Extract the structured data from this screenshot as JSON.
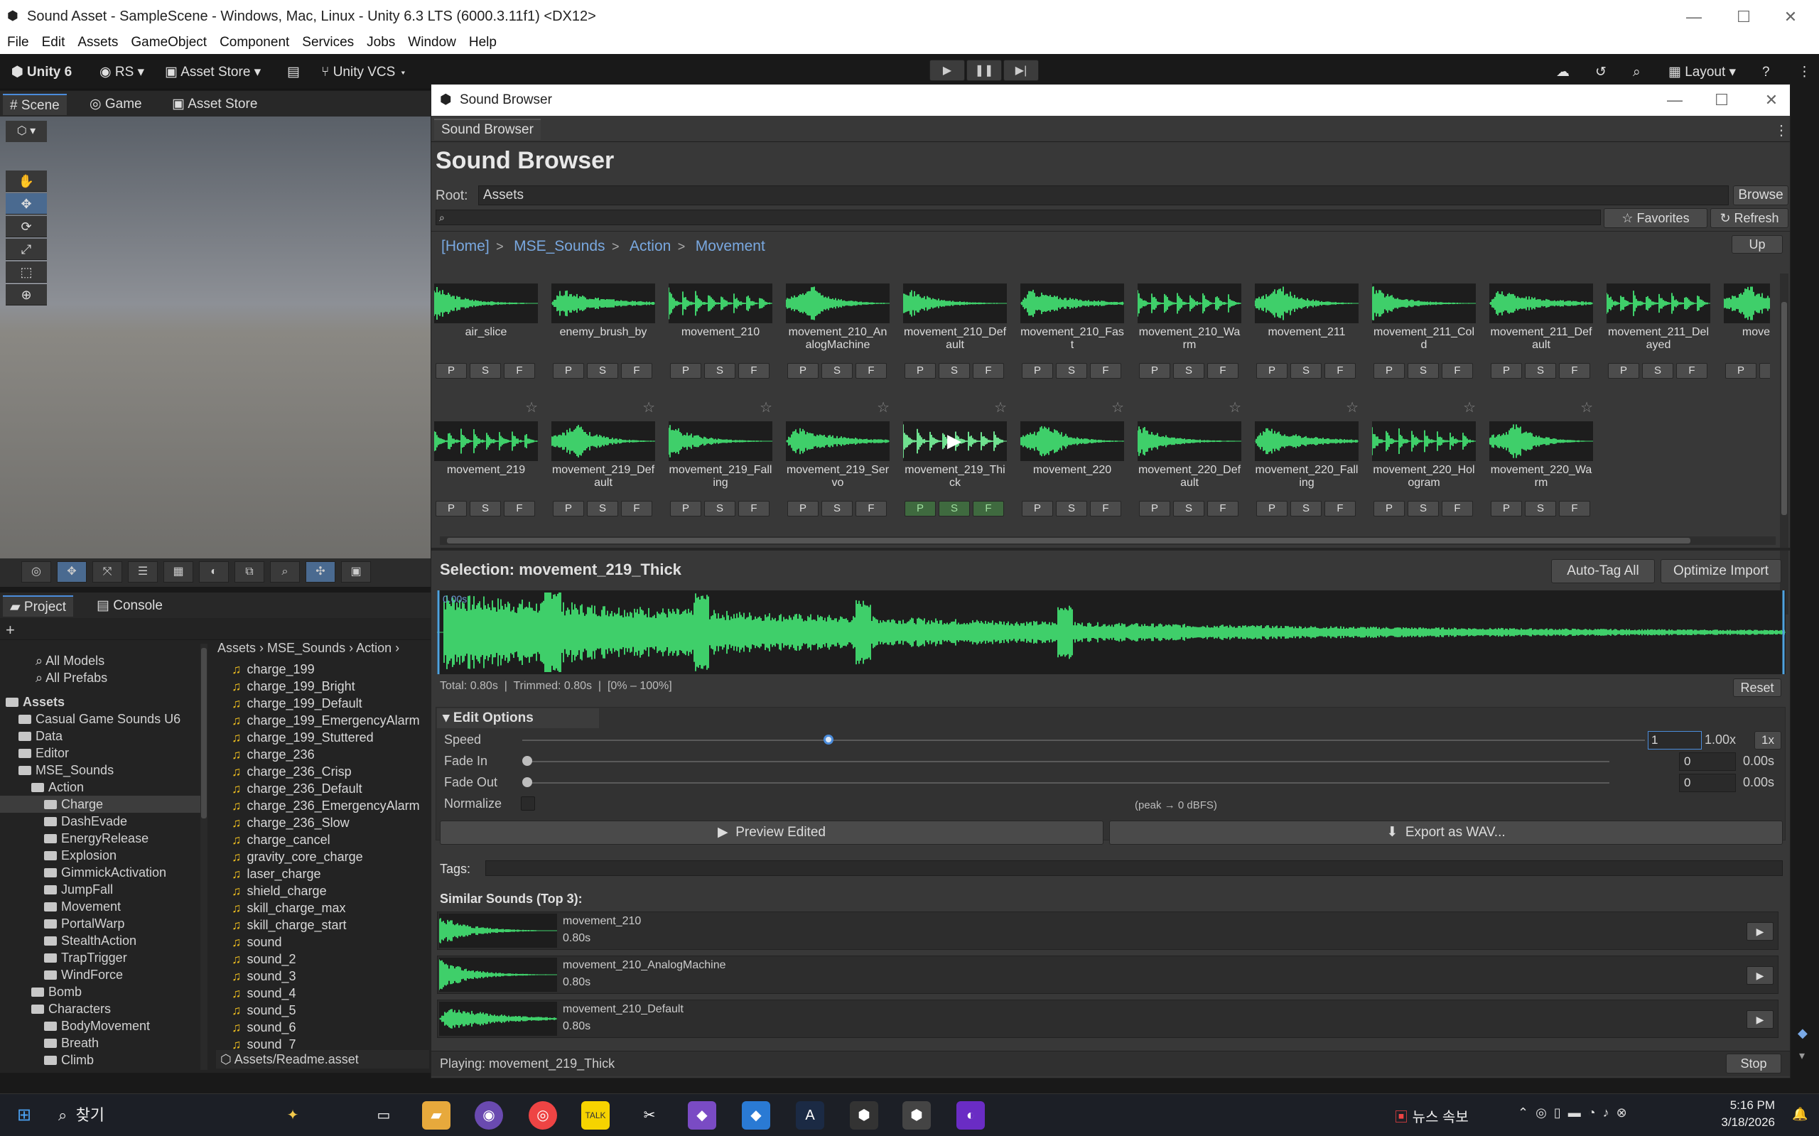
{
  "window": {
    "title": "Sound Asset - SampleScene - Windows, Mac, Linux - Unity 6.3 LTS (6000.3.11f1) <DX12>"
  },
  "menu": [
    "File",
    "Edit",
    "Assets",
    "GameObject",
    "Component",
    "Services",
    "Jobs",
    "Window",
    "Help"
  ],
  "toolbar": {
    "unity": "Unity 6",
    "account": "RS",
    "asset_store": "Asset Store",
    "vcs": "Unity VCS",
    "layout": "Layout"
  },
  "scene_tabs": [
    "Scene",
    "Game",
    "Asset Store"
  ],
  "project_tabs": [
    "Project",
    "Console"
  ],
  "project": {
    "search_items": [
      "All Models",
      "All Prefabs"
    ],
    "tree": [
      {
        "label": "Assets",
        "indent": 0,
        "bold": true
      },
      {
        "label": "Casual Game Sounds U6",
        "indent": 1
      },
      {
        "label": "Data",
        "indent": 1
      },
      {
        "label": "Editor",
        "indent": 1
      },
      {
        "label": "MSE_Sounds",
        "indent": 1
      },
      {
        "label": "Action",
        "indent": 2
      },
      {
        "label": "Charge",
        "indent": 3,
        "selected": true
      },
      {
        "label": "DashEvade",
        "indent": 3
      },
      {
        "label": "EnergyRelease",
        "indent": 3
      },
      {
        "label": "Explosion",
        "indent": 3
      },
      {
        "label": "GimmickActivation",
        "indent": 3
      },
      {
        "label": "JumpFall",
        "indent": 3
      },
      {
        "label": "Movement",
        "indent": 3
      },
      {
        "label": "PortalWarp",
        "indent": 3
      },
      {
        "label": "StealthAction",
        "indent": 3
      },
      {
        "label": "TrapTrigger",
        "indent": 3
      },
      {
        "label": "WindForce",
        "indent": 3
      },
      {
        "label": "Bomb",
        "indent": 2
      },
      {
        "label": "Characters",
        "indent": 2
      },
      {
        "label": "BodyMovement",
        "indent": 3
      },
      {
        "label": "Breath",
        "indent": 3
      },
      {
        "label": "Climb",
        "indent": 3
      }
    ],
    "breadcrumb": [
      "Assets",
      "MSE_Sounds",
      "Action"
    ],
    "files": [
      "charge_199",
      "charge_199_Bright",
      "charge_199_Default",
      "charge_199_EmergencyAlarm",
      "charge_199_Stuttered",
      "charge_236",
      "charge_236_Crisp",
      "charge_236_Default",
      "charge_236_EmergencyAlarm",
      "charge_236_Slow",
      "charge_cancel",
      "gravity_core_charge",
      "laser_charge",
      "shield_charge",
      "skill_charge_max",
      "skill_charge_start",
      "sound",
      "sound_2",
      "sound_3",
      "sound_4",
      "sound_5",
      "sound_6",
      "sound_7"
    ],
    "status_path": "Assets/Readme.asset"
  },
  "sb": {
    "window_title": "Sound Browser",
    "tab": "Sound Browser",
    "heading": "Sound Browser",
    "root_label": "Root:",
    "root_value": "Assets",
    "browse": "Browse",
    "favorites": "☆ Favorites",
    "refresh": "↻ Refresh",
    "crumbs": [
      "[Home]",
      "MSE_Sounds",
      "Action",
      "Movement"
    ],
    "up": "Up",
    "row1": [
      "air_slice",
      "enemy_brush_by",
      "movement_210",
      "movement_210_AnalogMachine",
      "movement_210_Default",
      "movement_210_Fast",
      "movement_210_Warm",
      "movement_211",
      "movement_211_Cold",
      "movement_211_Default",
      "movement_211_Delayed",
      "movement_P"
    ],
    "row2": [
      "movement_219",
      "movement_219_Default",
      "movement_219_Falling",
      "movement_219_Servo",
      "movement_219_Thick",
      "movement_220",
      "movement_220_Default",
      "movement_220_Falling",
      "movement_220_Hologram",
      "movement_220_Warm"
    ],
    "psf": [
      "P",
      "S",
      "F"
    ],
    "selection": "Selection: movement_219_Thick",
    "auto_tag": "Auto-Tag All",
    "optimize": "Optimize Import",
    "time_start": "0.00s",
    "total": "Total: 0.80s",
    "trimmed": "Trimmed: 0.80s",
    "range": "[0% – 100%]",
    "reset": "Reset",
    "edit_options": "Edit Options",
    "speed_label": "Speed",
    "speed_value": 1.0,
    "speed_input": "1",
    "speed_text": "1.00x",
    "speed_btn": "1x",
    "fadein_label": "Fade In",
    "fadein_input": "0",
    "fadein_text": "0.00s",
    "fadeout_label": "Fade Out",
    "fadeout_input": "0",
    "fadeout_text": "0.00s",
    "normalize_label": "Normalize",
    "normalize_hint": "(peak → 0 dBFS)",
    "preview": "Preview Edited",
    "export": "Export as WAV...",
    "tags_label": "Tags:",
    "similar_heading": "Similar Sounds (Top 3):",
    "similar": [
      {
        "name": "movement_210",
        "dur": "0.80s"
      },
      {
        "name": "movement_210_AnalogMachine",
        "dur": "0.80s"
      },
      {
        "name": "movement_210_Default",
        "dur": "0.80s"
      }
    ],
    "playing": "Playing: movement_219_Thick",
    "stop": "Stop"
  },
  "taskbar": {
    "search": "찾기",
    "news": "뉴스 속보",
    "time": "5:16 PM",
    "date": "3/18/2026"
  },
  "colors": {
    "wave": "#3fcf6a",
    "accent": "#79a8e0"
  }
}
